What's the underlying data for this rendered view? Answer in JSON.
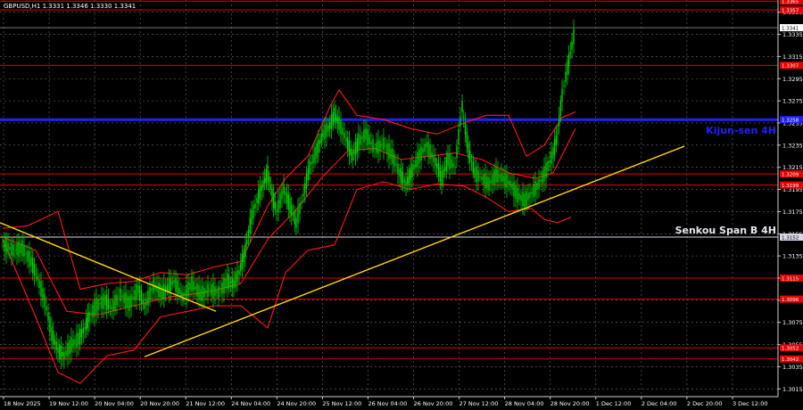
{
  "header": {
    "symbol_line": "GBPUSD,H1  1.3331 1.3346 1.3330 1.3341"
  },
  "chart_data": {
    "type": "line",
    "symbol": "GBPUSD",
    "timeframe": "H1",
    "ohlc_header": {
      "open": 1.3331,
      "high": 1.3346,
      "low": 1.333,
      "close": 1.3341
    },
    "price_axis": {
      "ticks": [
        1.3015,
        1.3035,
        1.3055,
        1.3075,
        1.3095,
        1.3115,
        1.3135,
        1.3155,
        1.3175,
        1.3195,
        1.3215,
        1.3235,
        1.3255,
        1.3275,
        1.3295,
        1.3315,
        1.3335,
        1.3355
      ],
      "ylim": [
        1.3008,
        1.3366
      ]
    },
    "time_axis": {
      "labels": [
        "18 Nov 2025",
        "19 Nov 12:00",
        "20 Nov 04:00",
        "20 Nov 20:00",
        "21 Nov 12:00",
        "24 Nov 04:00",
        "24 Nov 20:00",
        "25 Nov 12:00",
        "26 Nov 04:00",
        "26 Nov 20:00",
        "27 Nov 12:00",
        "28 Nov 04:00",
        "28 Nov 20:00",
        "1 Dec 12:00",
        "2 Dec 04:00",
        "2 Dec 20:00",
        "3 Dec 12:00"
      ]
    },
    "last_price": 1.3341,
    "price_levels": [
      {
        "value": 1.3365,
        "label": "1.3365",
        "color": "#e60000"
      },
      {
        "value": 1.3357,
        "label": "1.3357",
        "color": "#e60000"
      },
      {
        "value": 1.3307,
        "label": "1.3307",
        "color": "#e60000"
      },
      {
        "value": 1.3258,
        "label": "1.3258",
        "color": "#2020ff",
        "width": 3,
        "caption": "Kijun-sen 4H"
      },
      {
        "value": 1.3209,
        "label": "1.3209",
        "color": "#e60000"
      },
      {
        "value": 1.3199,
        "label": "1.3199",
        "color": "#e60000"
      },
      {
        "value": 1.3152,
        "label": "1.3152",
        "color": "#d8d8e8",
        "caption": "Senkou Span B 4H"
      },
      {
        "value": 1.3115,
        "label": "1.3115",
        "color": "#e60000"
      },
      {
        "value": 1.3096,
        "label": "1.3096",
        "color": "#e60000"
      },
      {
        "value": 1.3052,
        "label": "1.3052",
        "color": "#e60000"
      },
      {
        "value": 1.3042,
        "label": "1.3042",
        "color": "#e60000"
      }
    ],
    "trendlines": [
      {
        "name": "descending-trendline",
        "x": [
          0,
          242
        ],
        "y": [
          1.3165,
          1.3085
        ],
        "color": "#ffd700"
      },
      {
        "name": "ascending-trendline",
        "x": [
          162,
          767
        ],
        "y": [
          1.3044,
          1.3234
        ],
        "color": "#ffd700"
      }
    ],
    "price_path": {
      "x": [
        3,
        15,
        25,
        35,
        42,
        50,
        58,
        65,
        72,
        80,
        88,
        95,
        100,
        108,
        118,
        125,
        135,
        145,
        155,
        162,
        172,
        182,
        195,
        205,
        215,
        225,
        235,
        245,
        255,
        262,
        268,
        275,
        282,
        288,
        295,
        300,
        305,
        310,
        318,
        325,
        332,
        340,
        347,
        355,
        362,
        368,
        375,
        380,
        388,
        395,
        402,
        410,
        420,
        430,
        440,
        448,
        455,
        462,
        470,
        478,
        488,
        495,
        502,
        510,
        518,
        525,
        532,
        540,
        548,
        556,
        564,
        572,
        580,
        588,
        596,
        604,
        612,
        620,
        625,
        630,
        636,
        641,
        645
      ],
      "y": [
        1.3145,
        1.314,
        1.3142,
        1.313,
        1.3115,
        1.3095,
        1.3065,
        1.305,
        1.3045,
        1.3055,
        1.306,
        1.307,
        1.308,
        1.309,
        1.3095,
        1.3088,
        1.31,
        1.3092,
        1.3105,
        1.309,
        1.3108,
        1.3102,
        1.3112,
        1.3098,
        1.311,
        1.31,
        1.3105,
        1.3102,
        1.3112,
        1.311,
        1.312,
        1.314,
        1.317,
        1.3185,
        1.32,
        1.321,
        1.319,
        1.3175,
        1.3195,
        1.318,
        1.3165,
        1.319,
        1.3215,
        1.323,
        1.3245,
        1.325,
        1.3262,
        1.3255,
        1.324,
        1.3225,
        1.3238,
        1.3245,
        1.3232,
        1.3236,
        1.3225,
        1.321,
        1.32,
        1.3212,
        1.3225,
        1.3235,
        1.322,
        1.3205,
        1.3222,
        1.3215,
        1.327,
        1.323,
        1.321,
        1.3205,
        1.32,
        1.3208,
        1.3205,
        1.32,
        1.319,
        1.3185,
        1.3192,
        1.32,
        1.3212,
        1.3228,
        1.3245,
        1.328,
        1.3305,
        1.3325,
        1.3341
      ]
    },
    "ichimoku_upper": {
      "x": [
        3,
        30,
        65,
        90,
        120,
        150,
        180,
        210,
        240,
        270,
        300,
        320,
        345,
        370,
        380,
        400,
        430,
        460,
        490,
        520,
        545,
        570,
        590,
        610,
        630,
        645
      ],
      "y": [
        1.316,
        1.3162,
        1.3175,
        1.3105,
        1.311,
        1.3112,
        1.312,
        1.3118,
        1.3125,
        1.313,
        1.318,
        1.3205,
        1.3225,
        1.327,
        1.3285,
        1.3262,
        1.3258,
        1.325,
        1.3245,
        1.3255,
        1.3262,
        1.3262,
        1.3225,
        1.3235,
        1.326,
        1.3265
      ]
    },
    "ichimoku_lower": {
      "x": [
        3,
        40,
        65,
        90,
        120,
        150,
        180,
        210,
        240,
        270,
        300,
        320,
        345,
        375,
        400,
        430,
        460,
        490,
        520,
        545,
        570,
        595,
        610,
        625,
        640
      ],
      "y": [
        1.315,
        1.308,
        1.303,
        1.302,
        1.3045,
        1.305,
        1.308,
        1.3085,
        1.309,
        1.309,
        1.307,
        1.312,
        1.314,
        1.3145,
        1.3195,
        1.3202,
        1.3195,
        1.32,
        1.3198,
        1.3188,
        1.3175,
        1.3178,
        1.3168,
        1.3165,
        1.317
      ]
    },
    "ichimoku_mid": {
      "x": [
        3,
        40,
        75,
        110,
        150,
        190,
        230,
        270,
        300,
        330,
        360,
        390,
        420,
        450,
        480,
        510,
        540,
        570,
        600,
        620,
        645
      ],
      "y": [
        1.3152,
        1.314,
        1.3085,
        1.3082,
        1.309,
        1.3098,
        1.3102,
        1.311,
        1.315,
        1.3175,
        1.3205,
        1.323,
        1.3232,
        1.3222,
        1.3225,
        1.3228,
        1.3222,
        1.321,
        1.3205,
        1.321,
        1.325
      ]
    },
    "colors": {
      "background": "#000000",
      "candle": "#00d000",
      "grid": "#9a9a9a",
      "ichimoku": "#ff1a1a",
      "trendline": "#ffd700",
      "kijun": "#2020ff"
    }
  }
}
